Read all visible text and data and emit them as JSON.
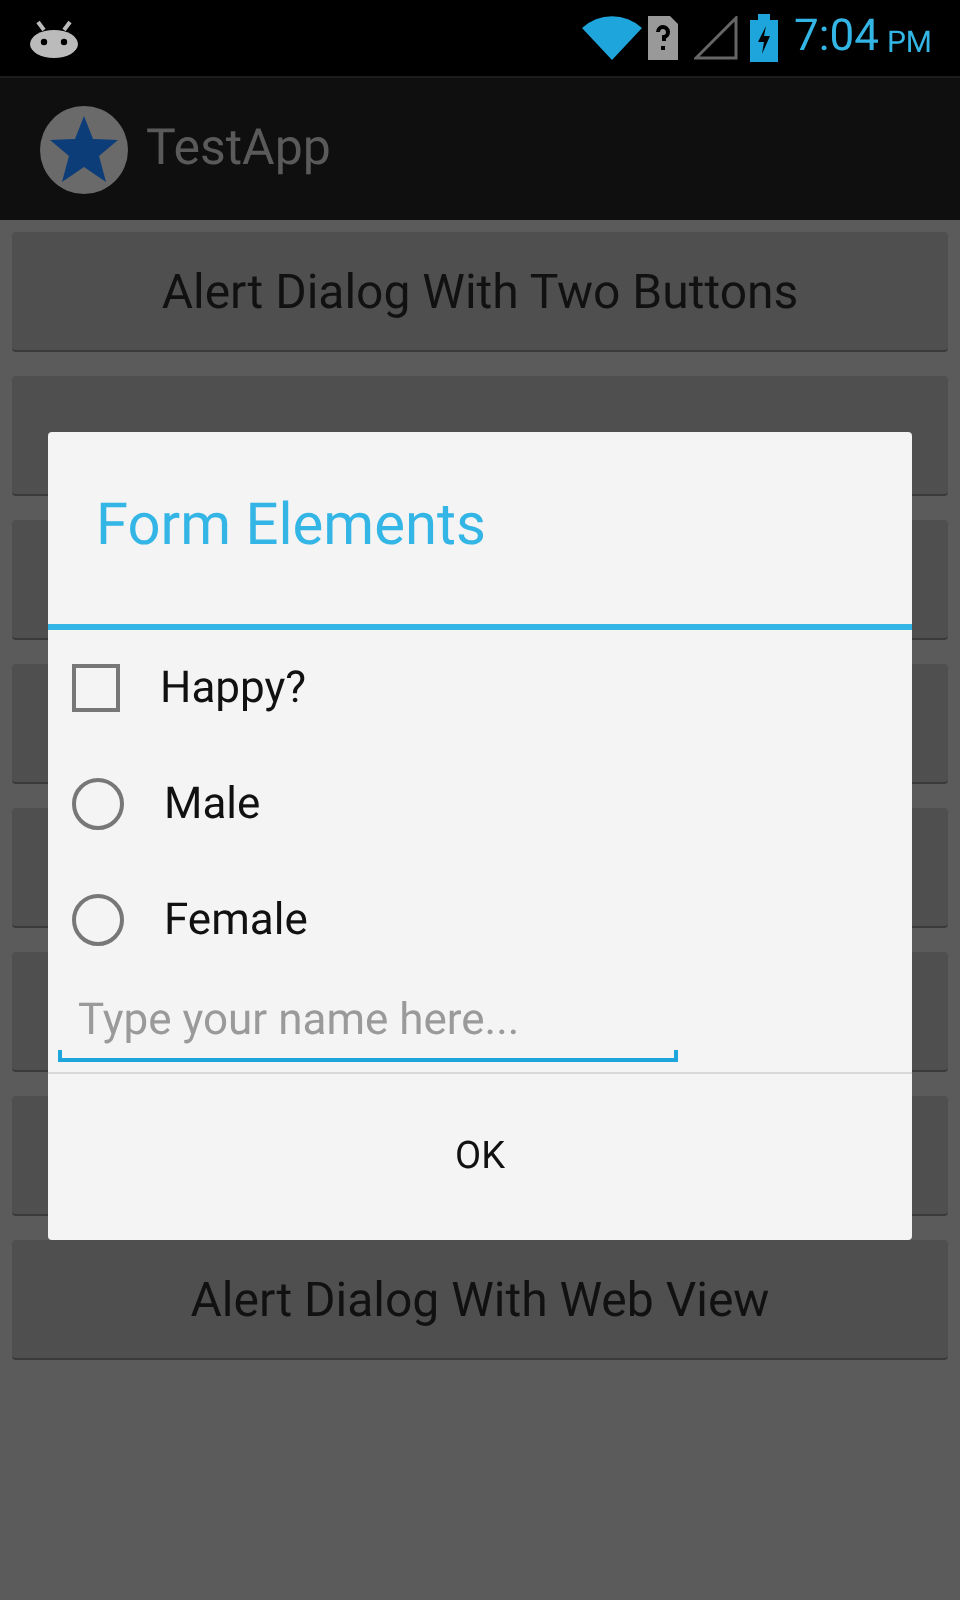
{
  "status_bar": {
    "time": "7:04",
    "period": "PM"
  },
  "action_bar": {
    "title": "TestApp"
  },
  "buttons": [
    {
      "kind": "labeled",
      "label": "Alert Dialog With Two Buttons"
    },
    {
      "kind": "covered"
    },
    {
      "kind": "covered"
    },
    {
      "kind": "covered"
    },
    {
      "kind": "covered"
    },
    {
      "kind": "covered"
    },
    {
      "kind": "covered"
    },
    {
      "kind": "labeled",
      "label": "Alert Dialog With Web View"
    }
  ],
  "dialog": {
    "title": "Form Elements",
    "options": [
      {
        "kind": "checkbox",
        "label": "Happy?",
        "checked": false
      },
      {
        "kind": "radio",
        "label": "Male",
        "selected": false
      },
      {
        "kind": "radio",
        "label": "Female",
        "selected": false
      }
    ],
    "name_field": {
      "placeholder": "Type your name here..."
    },
    "button": "OK"
  }
}
